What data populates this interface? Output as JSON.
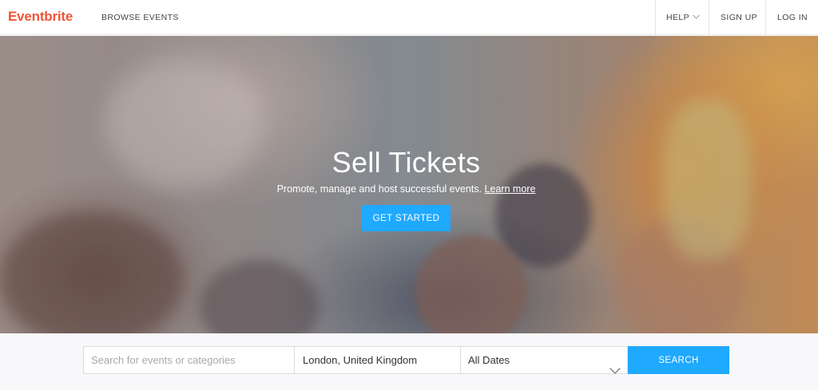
{
  "header": {
    "logo": "Eventbrite",
    "browse": "BROWSE EVENTS",
    "help": "HELP",
    "signup": "SIGN UP",
    "login": "LOG IN"
  },
  "hero": {
    "title": "Sell Tickets",
    "subtitle": "Promote, manage and host successful events.",
    "learn_more": "Learn more",
    "cta": "GET STARTED"
  },
  "search": {
    "placeholder": "Search for events or categories",
    "location": "London, United Kingdom",
    "dates": "All Dates",
    "button": "SEARCH"
  },
  "colors": {
    "brand": "#f05537",
    "accent": "#1fa9ff"
  },
  "icons": {
    "help_dropdown": "chevron-down-icon",
    "dates_dropdown": "chevron-down-icon"
  }
}
